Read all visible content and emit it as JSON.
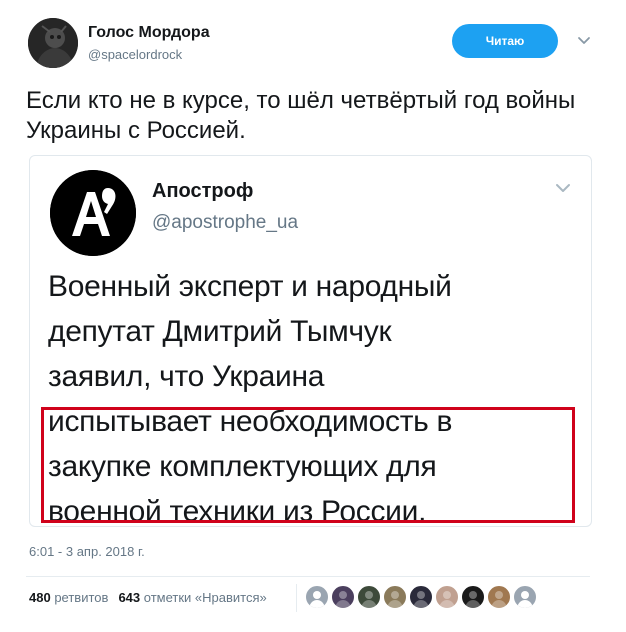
{
  "author": {
    "name": "Голос Мордора",
    "handle": "@spacelordrock",
    "avatar_icon": "user-avatar"
  },
  "follow_button": {
    "label": "Читаю",
    "color": "#1da1f2"
  },
  "tweet": {
    "text": "Если кто не в курсе, то шёл четвёртый год войны Украины с Россией."
  },
  "embedded_tweet": {
    "name": "Апостроф",
    "handle": "@apostrophe_ua",
    "avatar_icon": "apostrophe-logo",
    "text_lines": [
      "Военный эксперт и народный",
      "депутат Дмитрий Тымчук",
      "заявил, что Украина",
      "испытывает необходимость в",
      "закупке комплектующих для",
      "военной техники из России."
    ],
    "highlight_color": "#d0021b"
  },
  "timestamp": "6:01 - 3 апр. 2018 г.",
  "stats": {
    "retweets_count": "480",
    "retweets_label": "ретвитов",
    "likes_count": "643",
    "likes_label": "отметки «Нравится»"
  },
  "likers": [
    {
      "icon": "default-avatar",
      "color": "#9aa5b1"
    },
    {
      "icon": "user-avatar",
      "color": "#4b3f5e"
    },
    {
      "icon": "user-avatar",
      "color": "#3d4a3a"
    },
    {
      "icon": "user-avatar",
      "color": "#8a7a5a"
    },
    {
      "icon": "user-avatar",
      "color": "#2a2a3a"
    },
    {
      "icon": "user-avatar",
      "color": "#c0a090"
    },
    {
      "icon": "user-avatar",
      "color": "#1a1a1a"
    },
    {
      "icon": "user-avatar",
      "color": "#a07850"
    },
    {
      "icon": "default-avatar",
      "color": "#9aa5b1"
    }
  ]
}
